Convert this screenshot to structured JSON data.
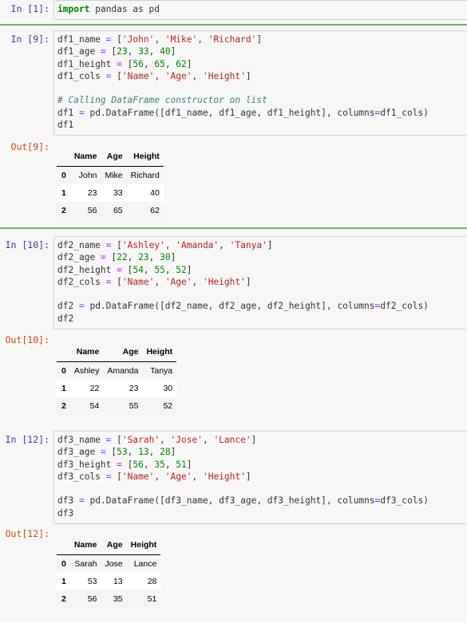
{
  "cells": [
    {
      "in_prompt": "In [1]:",
      "code": [
        "import pandas as pd"
      ]
    },
    {
      "in_prompt": "In [9]:",
      "code": [
        "df1_name = ['John', 'Mike', 'Richard']",
        "df1_age = [23, 33, 40]",
        "df1_height = [56, 65, 62]",
        "df1_cols = ['Name', 'Age', 'Height']",
        "",
        "# Calling DataFrame constructor on list",
        "df1 = pd.DataFrame([df1_name, df1_age, df1_height], columns=df1_cols)",
        "df1"
      ],
      "out_prompt": "Out[9]:",
      "table": {
        "columns": [
          "",
          "Name",
          "Age",
          "Height"
        ],
        "rows": [
          [
            "0",
            "John",
            "Mike",
            "Richard"
          ],
          [
            "1",
            "23",
            "33",
            "40"
          ],
          [
            "2",
            "56",
            "65",
            "62"
          ]
        ]
      }
    },
    {
      "in_prompt": "In [10]:",
      "code": [
        "df2_name = ['Ashley', 'Amanda', 'Tanya']",
        "df2_age = [22, 23, 30]",
        "df2_height = [54, 55, 52]",
        "df2_cols = ['Name', 'Age', 'Height']",
        "",
        "df2 = pd.DataFrame([df2_name, df2_age, df2_height], columns=df2_cols)",
        "df2"
      ],
      "out_prompt": "Out[10]:",
      "table": {
        "columns": [
          "",
          "Name",
          "Age",
          "Height"
        ],
        "rows": [
          [
            "0",
            "Ashley",
            "Amanda",
            "Tanya"
          ],
          [
            "1",
            "22",
            "23",
            "30"
          ],
          [
            "2",
            "54",
            "55",
            "52"
          ]
        ]
      }
    },
    {
      "in_prompt": "In [12]:",
      "code": [
        "df3_name = ['Sarah', 'Jose', 'Lance']",
        "df3_age = [53, 13, 28]",
        "df3_height = [56, 35, 51]",
        "df3_cols = ['Name', 'Age', 'Height']",
        "",
        "df3 = pd.DataFrame([df3_name, df3_age, df3_height], columns=df3_cols)",
        "df3"
      ],
      "out_prompt": "Out[12]:",
      "table": {
        "columns": [
          "",
          "Name",
          "Age",
          "Height"
        ],
        "rows": [
          [
            "0",
            "Sarah",
            "Jose",
            "Lance"
          ],
          [
            "1",
            "53",
            "13",
            "28"
          ],
          [
            "2",
            "56",
            "35",
            "51"
          ]
        ]
      }
    }
  ],
  "colors": {
    "in_prompt": "#303f9f",
    "out_prompt": "#d84315",
    "cell_separator": "#66bb6a",
    "keyword": "#008000",
    "string": "#ba2121",
    "number": "#008800",
    "operator": "#aa22ff",
    "comment": "#408080"
  }
}
